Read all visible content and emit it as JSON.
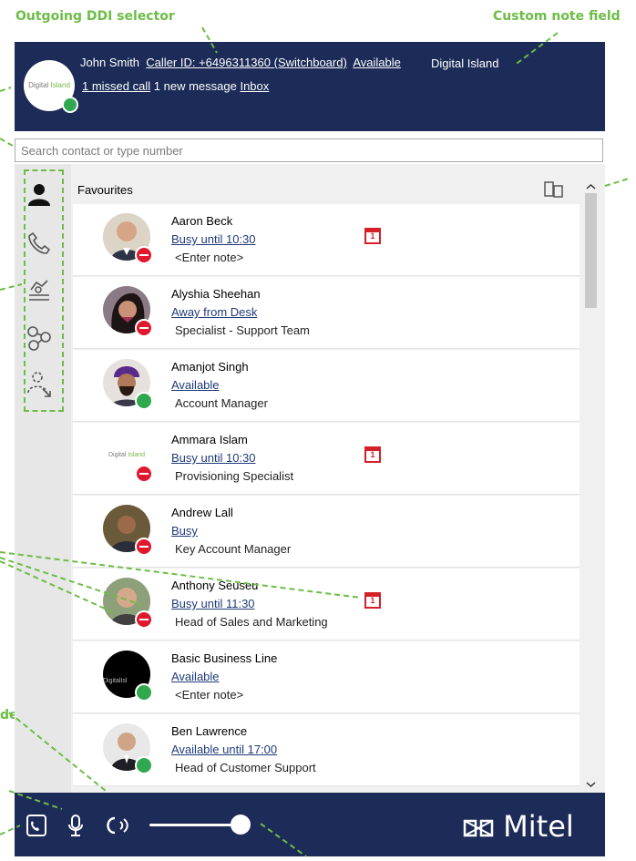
{
  "annotations": {
    "outgoing_ddi": "Outgoing DDI selector",
    "custom_note": "Custom note field",
    "side_fragment": "de"
  },
  "header": {
    "logo_text_1": "Digital",
    "logo_text_2": "Island",
    "user_name": "John Smith",
    "caller_id": "Caller ID: +6496311360 (Switchboard)",
    "availability": "Available",
    "note": "Digital Island",
    "missed_calls": "1 missed call",
    "messages": "1 new message",
    "inbox": "Inbox"
  },
  "search": {
    "placeholder": "Search contact or type number"
  },
  "favourites": {
    "title": "Favourites"
  },
  "contacts": [
    {
      "name": "Aaron Beck",
      "status": "Busy until 10:30",
      "note": "<Enter note>",
      "presence": "busy",
      "calendar": "1"
    },
    {
      "name": "Alyshia Sheehan",
      "status": "Away from Desk",
      "note": "Specialist - Support Team",
      "presence": "busy"
    },
    {
      "name": "Amanjot Singh",
      "status": "Available",
      "note": "Account Manager",
      "presence": "available"
    },
    {
      "name": "Ammara Islam",
      "status": "Busy until 10:30",
      "note": "Provisioning Specialist",
      "presence": "busy",
      "calendar": "1",
      "logo_text_1": "Digital",
      "logo_text_2": "Island"
    },
    {
      "name": "Andrew Lall",
      "status": "Busy",
      "note": "Key Account Manager",
      "presence": "busy"
    },
    {
      "name": "Anthony Seuseu",
      "status": "Busy until 11:30",
      "note": "Head of Sales and Marketing",
      "presence": "busy",
      "calendar": "1"
    },
    {
      "name": "Basic Business Line",
      "status": "Available",
      "note": "<Enter note>",
      "presence": "available",
      "logo_text_1": "Digital",
      "logo_text_2": "Isl"
    },
    {
      "name": "Ben Lawrence",
      "status": "Available until 17:00",
      "note": "Head of Customer Support",
      "presence": "available"
    }
  ],
  "footer": {
    "brand": "Mitel",
    "volume_level": 0.88
  },
  "colors": {
    "header_bg": "#1c2b57",
    "callout": "#6cbd45",
    "busy": "#e0182d",
    "available": "#2fa84f"
  }
}
